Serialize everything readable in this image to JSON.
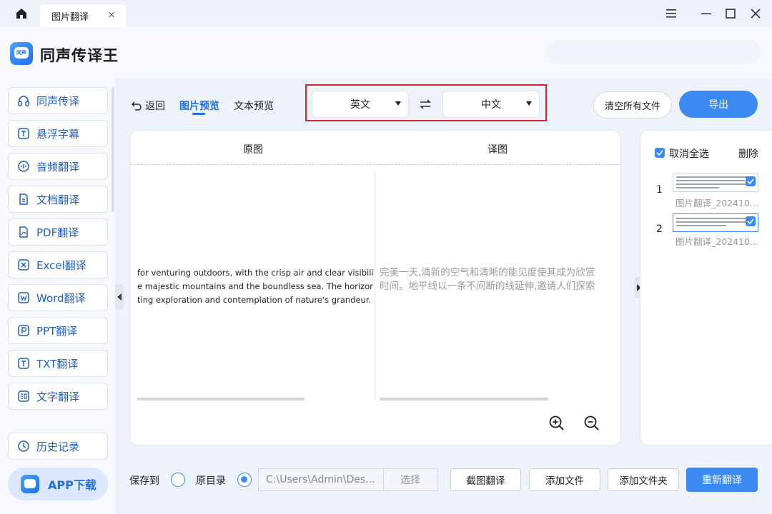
{
  "window": {
    "tab_title": "图片翻译",
    "tab_close": "×"
  },
  "app": {
    "title": "同声传译王",
    "logo_text": "同声"
  },
  "sidebar": {
    "items": [
      {
        "label": "同声传译",
        "icon": "headset-icon"
      },
      {
        "label": "悬浮字幕",
        "icon": "subtitle-icon"
      },
      {
        "label": "音频翻译",
        "icon": "audio-icon"
      },
      {
        "label": "文档翻译",
        "icon": "document-icon"
      },
      {
        "label": "PDF翻译",
        "icon": "pdf-icon"
      },
      {
        "label": "Excel翻译",
        "icon": "excel-icon"
      },
      {
        "label": "Word翻译",
        "icon": "word-icon"
      },
      {
        "label": "PPT翻译",
        "icon": "ppt-icon"
      },
      {
        "label": "TXT翻译",
        "icon": "txt-icon"
      },
      {
        "label": "文字翻译",
        "icon": "text-translate-icon"
      }
    ],
    "history": "历史记录",
    "app_download": "APP下载"
  },
  "toolbar": {
    "back": "返回",
    "tab_image_preview": "图片预览",
    "tab_text_preview": "文本预览",
    "source_lang": "英文",
    "target_lang": "中文",
    "clear_all": "清空所有文件",
    "export": "导出"
  },
  "preview": {
    "original_header": "原图",
    "translated_header": "译图",
    "source_lines": [
      "for venturing outdoors, with the crisp air and clear visibility ma",
      "e majestic mountains and the boundless sea. The horizon stre",
      "ting exploration and contemplation of nature's grandeur."
    ],
    "target_lines": [
      "完美一天,清新的空气和清晰的能见度使其成为欣赏",
      "时间。地平线以一条不间断的线延伸,邀请人们探索"
    ]
  },
  "files": {
    "deselect_all": "取消全选",
    "delete": "删除",
    "items": [
      {
        "index": "1",
        "name": "图片翻译_202410..."
      },
      {
        "index": "2",
        "name": "图片翻译_202410..."
      }
    ]
  },
  "bottom": {
    "save_to": "保存到",
    "original_dir": "原目录",
    "path": "C:\\Users\\Admin\\Des...",
    "choose": "选择",
    "screenshot_translate": "截图翻译",
    "add_file": "添加文件",
    "add_folder": "添加文件夹",
    "retranslate": "重新翻译"
  },
  "colors": {
    "accent": "#3b8af3",
    "highlight_box": "#d9262c",
    "background": "#eef3fb"
  }
}
